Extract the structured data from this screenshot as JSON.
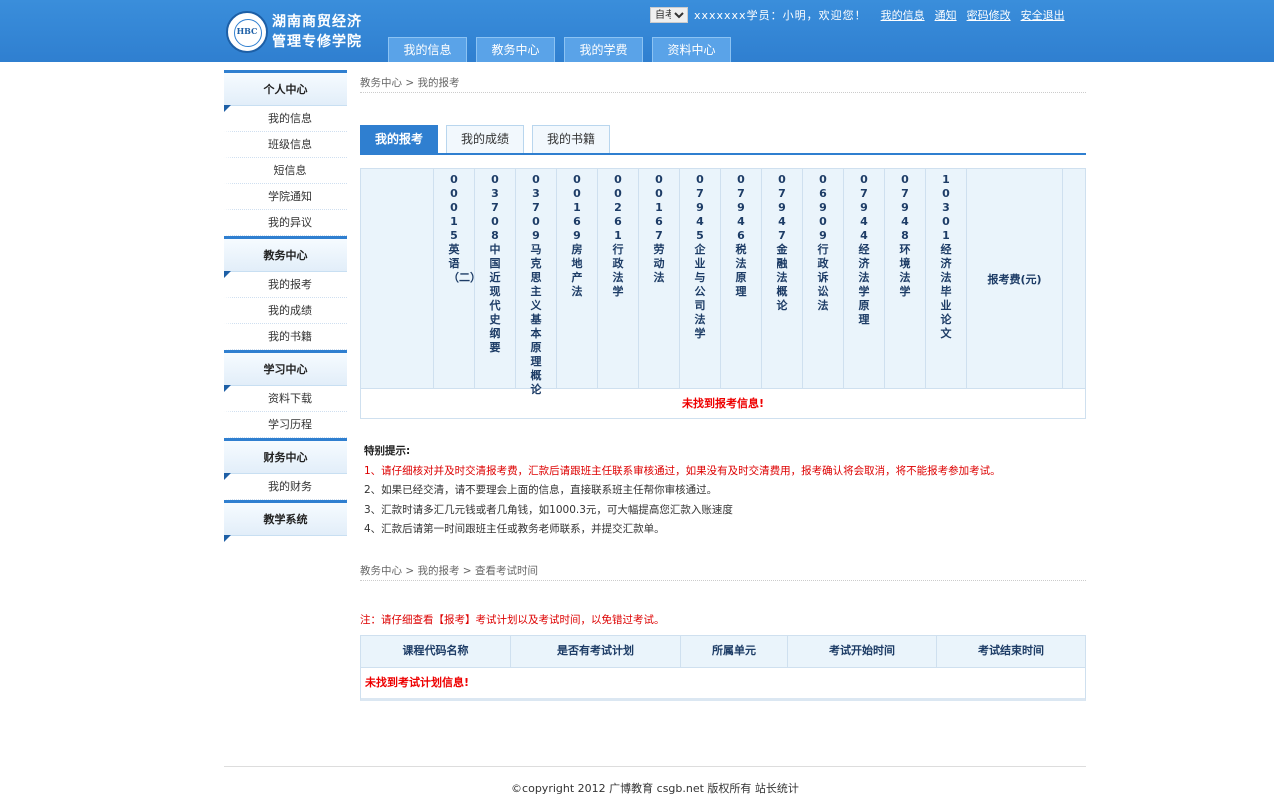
{
  "header": {
    "logo_lines": [
      "湖南商贸经济",
      "管理专修学院"
    ],
    "logo_seal": "HBC",
    "select_value": "自考",
    "welcome": "xxxxxxx学员：小明，欢迎您！",
    "links": [
      "我的信息",
      "通知",
      "密码修改",
      "安全退出"
    ],
    "nav": [
      "我的信息",
      "教务中心",
      "我的学费",
      "资料中心"
    ]
  },
  "sidebar": [
    {
      "title": "个人中心",
      "items": [
        "我的信息",
        "班级信息",
        "短信息",
        "学院通知",
        "我的异议"
      ]
    },
    {
      "title": "教务中心",
      "items": [
        "我的报考",
        "我的成绩",
        "我的书籍"
      ]
    },
    {
      "title": "学习中心",
      "items": [
        "资料下载",
        "学习历程"
      ]
    },
    {
      "title": "财务中心",
      "items": [
        "我的财务"
      ]
    },
    {
      "title": "教学系统",
      "items": []
    }
  ],
  "breadcrumb1": "教务中心 > 我的报考",
  "tabs": [
    "我的报考",
    "我的成绩",
    "我的书籍"
  ],
  "courses": [
    "00015英语（二）",
    "03708中国近现代史纲要",
    "03709马克思主义基本原理概论",
    "00169房地产法",
    "00261行政法学",
    "00167劳动法",
    "07945企业与公司法学",
    "07946税法原理",
    "07947金融法概论",
    "06909行政诉讼法",
    "07944经济法学原理",
    "07948环境法学",
    "10301经济法毕业论文"
  ],
  "fee_header": "报考费(元)",
  "no_exam_info": "未找到报考信息!",
  "notes": {
    "title": "特别提示:",
    "items": [
      "1、请仔细核对并及时交清报考费，汇款后请跟班主任联系审核通过，如果没有及时交清费用，报考确认将会取消，将不能报考参加考试。",
      "2、如果已经交清，请不要理会上面的信息，直接联系班主任帮你审核通过。",
      "3、汇款时请多汇几元钱或者几角钱，如1000.3元，可大幅提高您汇款入账速度",
      "4、汇款后请第一时间跟班主任或教务老师联系，并提交汇款单。"
    ]
  },
  "breadcrumb2": "教务中心 > 我的报考 > 查看考试时间",
  "note2": "注：请仔细查看【报考】考试计划以及考试时间，以免错过考试。",
  "plan_headers": [
    "课程代码名称",
    "是否有考试计划",
    "所属单元",
    "考试开始时间",
    "考试结束时间"
  ],
  "no_plan_info": "未找到考试计划信息!",
  "footer": "©copyright 2012 广博教育 csgb.net 版权所有 站长统计"
}
